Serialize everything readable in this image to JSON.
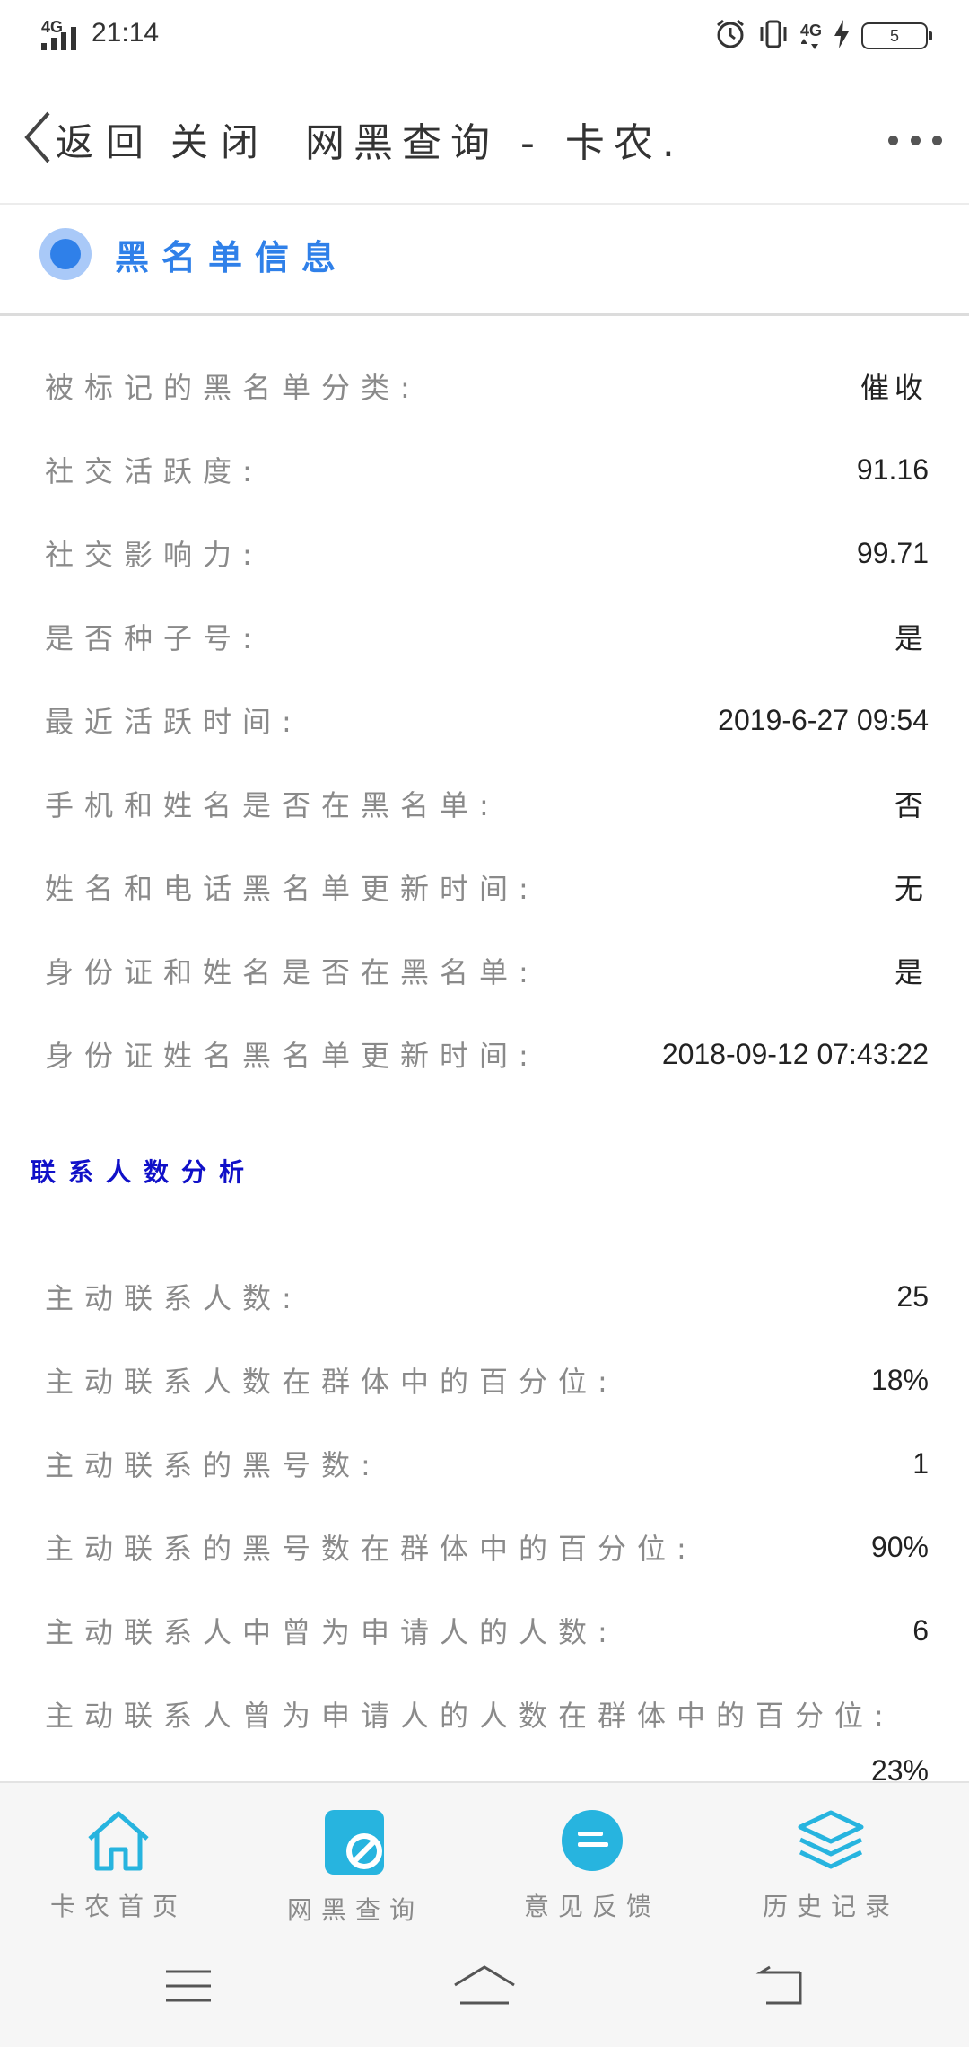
{
  "status_bar": {
    "network": "4G",
    "time": "21:14",
    "network_right": "4G",
    "battery": "5",
    "icons": [
      "signal-icon",
      "alarm-icon",
      "vibrate-icon",
      "network-icon",
      "charging-icon",
      "battery-icon"
    ]
  },
  "nav": {
    "back_label": "返回",
    "close_label": "关闭",
    "title": "网黑查询 - 卡农..."
  },
  "blacklist_section": {
    "title": "黑名单信息",
    "accent_color": "#2f80e9",
    "rows": [
      {
        "label": "被标记的黑名单分类:",
        "value": "催收"
      },
      {
        "label": "社交活跃度:",
        "value": "91.16"
      },
      {
        "label": "社交影响力:",
        "value": "99.71"
      },
      {
        "label": "是否种子号:",
        "value": "是"
      },
      {
        "label": "最近活跃时间:",
        "value": "2019-6-27 09:54"
      },
      {
        "label": "手机和姓名是否在黑名单:",
        "value": "否"
      },
      {
        "label": "姓名和电话黑名单更新时间:",
        "value": "无"
      },
      {
        "label": "身份证和姓名是否在黑名单:",
        "value": "是"
      },
      {
        "label": "身份证姓名黑名单更新时间:",
        "value": "2018-09-12 07:43:22"
      }
    ]
  },
  "contacts_section": {
    "title": "联系人数分析",
    "title_color": "#1010c8",
    "rows": [
      {
        "label": "主动联系人数:",
        "value": "25"
      },
      {
        "label": "主动联系人数在群体中的百分位:",
        "value": "18%"
      },
      {
        "label": "主动联系的黑号数:",
        "value": "1"
      },
      {
        "label": "主动联系的黑号数在群体中的百分位:",
        "value": "90%"
      },
      {
        "label": "主动联系人中曾为申请人的人数:",
        "value": "6"
      },
      {
        "label": "主动联系人曾为申请人的人数在群体中的百分位:",
        "value": "23%"
      }
    ]
  },
  "tabbar": {
    "active_color": "#27b4df",
    "tabs": [
      {
        "label": "卡农首页",
        "icon": "home-icon"
      },
      {
        "label": "网黑查询",
        "icon": "blacklist-query-icon"
      },
      {
        "label": "意见反馈",
        "icon": "feedback-icon"
      },
      {
        "label": "历史记录",
        "icon": "layers-icon"
      }
    ]
  },
  "system_nav": {
    "icons": [
      "menu-icon",
      "home-icon",
      "back-icon"
    ]
  }
}
